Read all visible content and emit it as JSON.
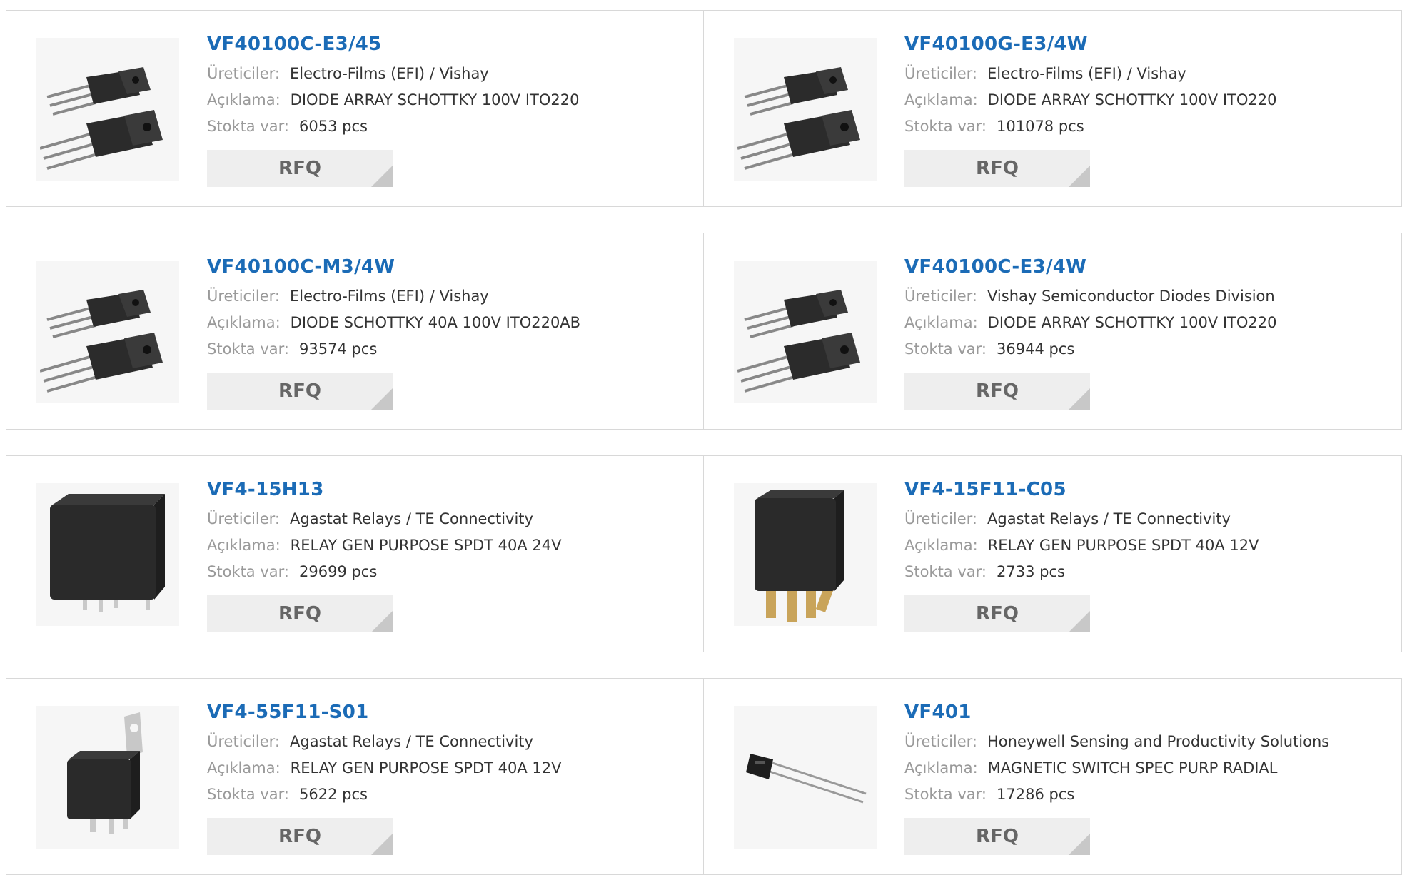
{
  "labels": {
    "manufacturer": "Üreticiler:",
    "description": "Açıklama:",
    "stock": "Stokta var:",
    "rfq": "RFQ"
  },
  "products": [
    {
      "part": "VF40100C-E3/45",
      "manufacturer": "Electro-Films (EFI) / Vishay",
      "description": "DIODE ARRAY SCHOTTKY 100V ITO220",
      "stock": "6053 pcs",
      "image": "to220-diode-icon"
    },
    {
      "part": "VF40100G-E3/4W",
      "manufacturer": "Electro-Films (EFI) / Vishay",
      "description": "DIODE ARRAY SCHOTTKY 100V ITO220",
      "stock": "101078 pcs",
      "image": "to220-diode-icon"
    },
    {
      "part": "VF40100C-M3/4W",
      "manufacturer": "Electro-Films (EFI) / Vishay",
      "description": "DIODE SCHOTTKY 40A 100V ITO220AB",
      "stock": "93574 pcs",
      "image": "to220-diode-icon"
    },
    {
      "part": "VF40100C-E3/4W",
      "manufacturer": "Vishay Semiconductor Diodes Division",
      "description": "DIODE ARRAY SCHOTTKY 100V ITO220",
      "stock": "36944 pcs",
      "image": "to220-diode-icon"
    },
    {
      "part": "VF4-15H13",
      "manufacturer": "Agastat Relays / TE Connectivity",
      "description": "RELAY GEN PURPOSE SPDT 40A 24V",
      "stock": "29699 pcs",
      "image": "relay-icon"
    },
    {
      "part": "VF4-15F11-C05",
      "manufacturer": "Agastat Relays / TE Connectivity",
      "description": "RELAY GEN PURPOSE SPDT 40A 12V",
      "stock": "2733 pcs",
      "image": "relay-pins-icon"
    },
    {
      "part": "VF4-55F11-S01",
      "manufacturer": "Agastat Relays / TE Connectivity",
      "description": "RELAY GEN PURPOSE SPDT 40A 12V",
      "stock": "5622 pcs",
      "image": "relay-bracket-icon"
    },
    {
      "part": "VF401",
      "manufacturer": "Honeywell Sensing and Productivity Solutions",
      "description": "MAGNETIC SWITCH SPEC PURP RADIAL",
      "stock": "17286 pcs",
      "image": "magnetic-switch-icon"
    }
  ],
  "colors": {
    "link": "#1b6bb6",
    "label": "#9a9a9a",
    "button": "#eeeeee"
  }
}
